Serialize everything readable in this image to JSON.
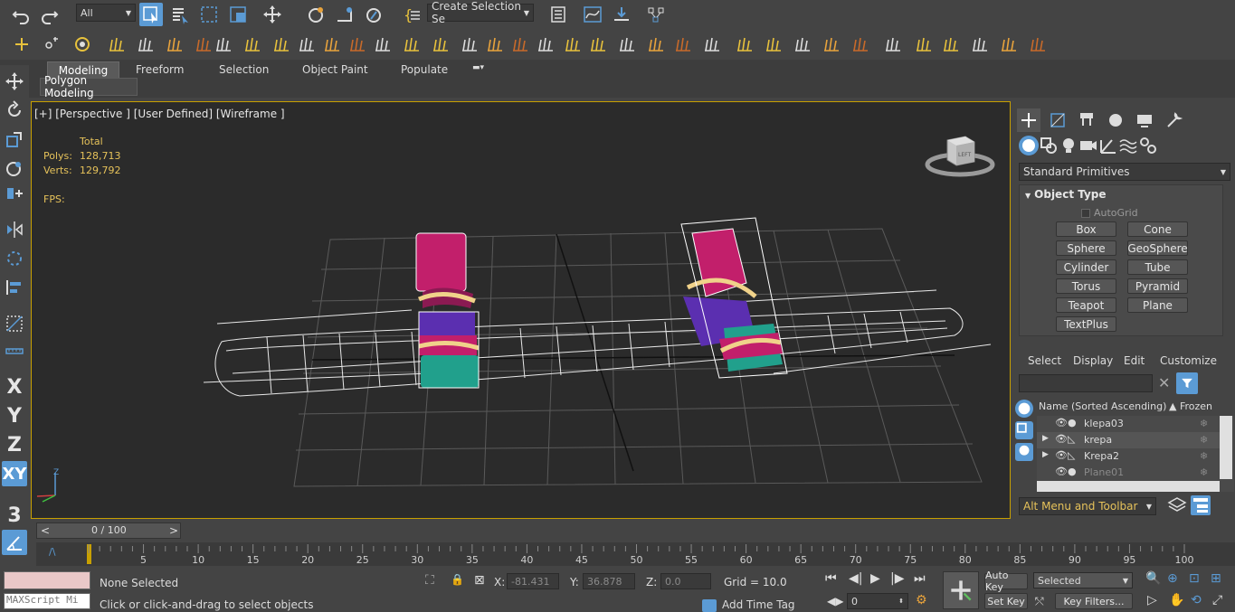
{
  "main_toolbar": {
    "selection_filter": "All",
    "named_selection": "Create Selection Se"
  },
  "ribbon": {
    "tabs": [
      {
        "label": "Modeling",
        "active": true
      },
      {
        "label": "Freeform",
        "active": false
      },
      {
        "label": "Selection",
        "active": false
      },
      {
        "label": "Object Paint",
        "active": false
      },
      {
        "label": "Populate",
        "active": false
      }
    ],
    "panel_label": "Polygon Modeling"
  },
  "viewport": {
    "label": "[+] [Perspective ] [User Defined] [Wireframe ]",
    "stats": {
      "total_label": "Total",
      "polys_label": "Polys:",
      "polys_value": "128,713",
      "verts_label": "Verts:",
      "verts_value": "129,792",
      "fps_label": "FPS:"
    },
    "viewcube_face": "LEFT",
    "axis_label": "Z"
  },
  "left_toolbar": {
    "x": "X",
    "y": "Y",
    "z": "Z",
    "xy": "XY",
    "snap": "3"
  },
  "command_panel": {
    "dropdown": "Standard Primitives",
    "rollout_title": "Object Type",
    "autogrid": "AutoGrid",
    "buttons": [
      "Box",
      "Cone",
      "Sphere",
      "GeoSphere",
      "Cylinder",
      "Tube",
      "Torus",
      "Pyramid",
      "Teapot",
      "Plane",
      "TextPlus"
    ]
  },
  "scene_explorer": {
    "menu": [
      "Select",
      "Display",
      "Edit",
      "Customize"
    ],
    "col_name": "Name (Sorted Ascending)",
    "col_frozen": "▲ Frozen",
    "rows": [
      {
        "name": "klepa03"
      },
      {
        "name": "krepa"
      },
      {
        "name": "Krepa2"
      },
      {
        "name": "Plane01"
      }
    ],
    "workspace": "Alt Menu and Toolbar"
  },
  "timeline": {
    "frame_display": "0 / 100",
    "ticks": [
      "5",
      "10",
      "15",
      "20",
      "25",
      "30",
      "35",
      "40",
      "45",
      "50",
      "55",
      "60",
      "65",
      "70",
      "75",
      "80",
      "85",
      "90",
      "95",
      "100"
    ]
  },
  "status": {
    "maxscript": "MAXScript Mi",
    "selection": "None Selected",
    "prompt": "Click or click-and-drag to select objects",
    "x_label": "X:",
    "x_value": "-81.431",
    "y_label": "Y:",
    "y_value": "36.878",
    "z_label": "Z:",
    "z_value": "0.0",
    "grid": "Grid = 10.0",
    "add_time_tag": "Add Time Tag",
    "auto_key": "Auto Key",
    "set_key": "Set Key",
    "key_mode": "Selected",
    "key_filters": "Key Filters...",
    "current_frame": "0"
  },
  "colors": {
    "ui_bg": "#444444",
    "viewport_bg": "#2b2b2b",
    "viewport_border": "#c8a000",
    "stats_text": "#e6c25a",
    "accent_blue": "#5b9bd5"
  }
}
